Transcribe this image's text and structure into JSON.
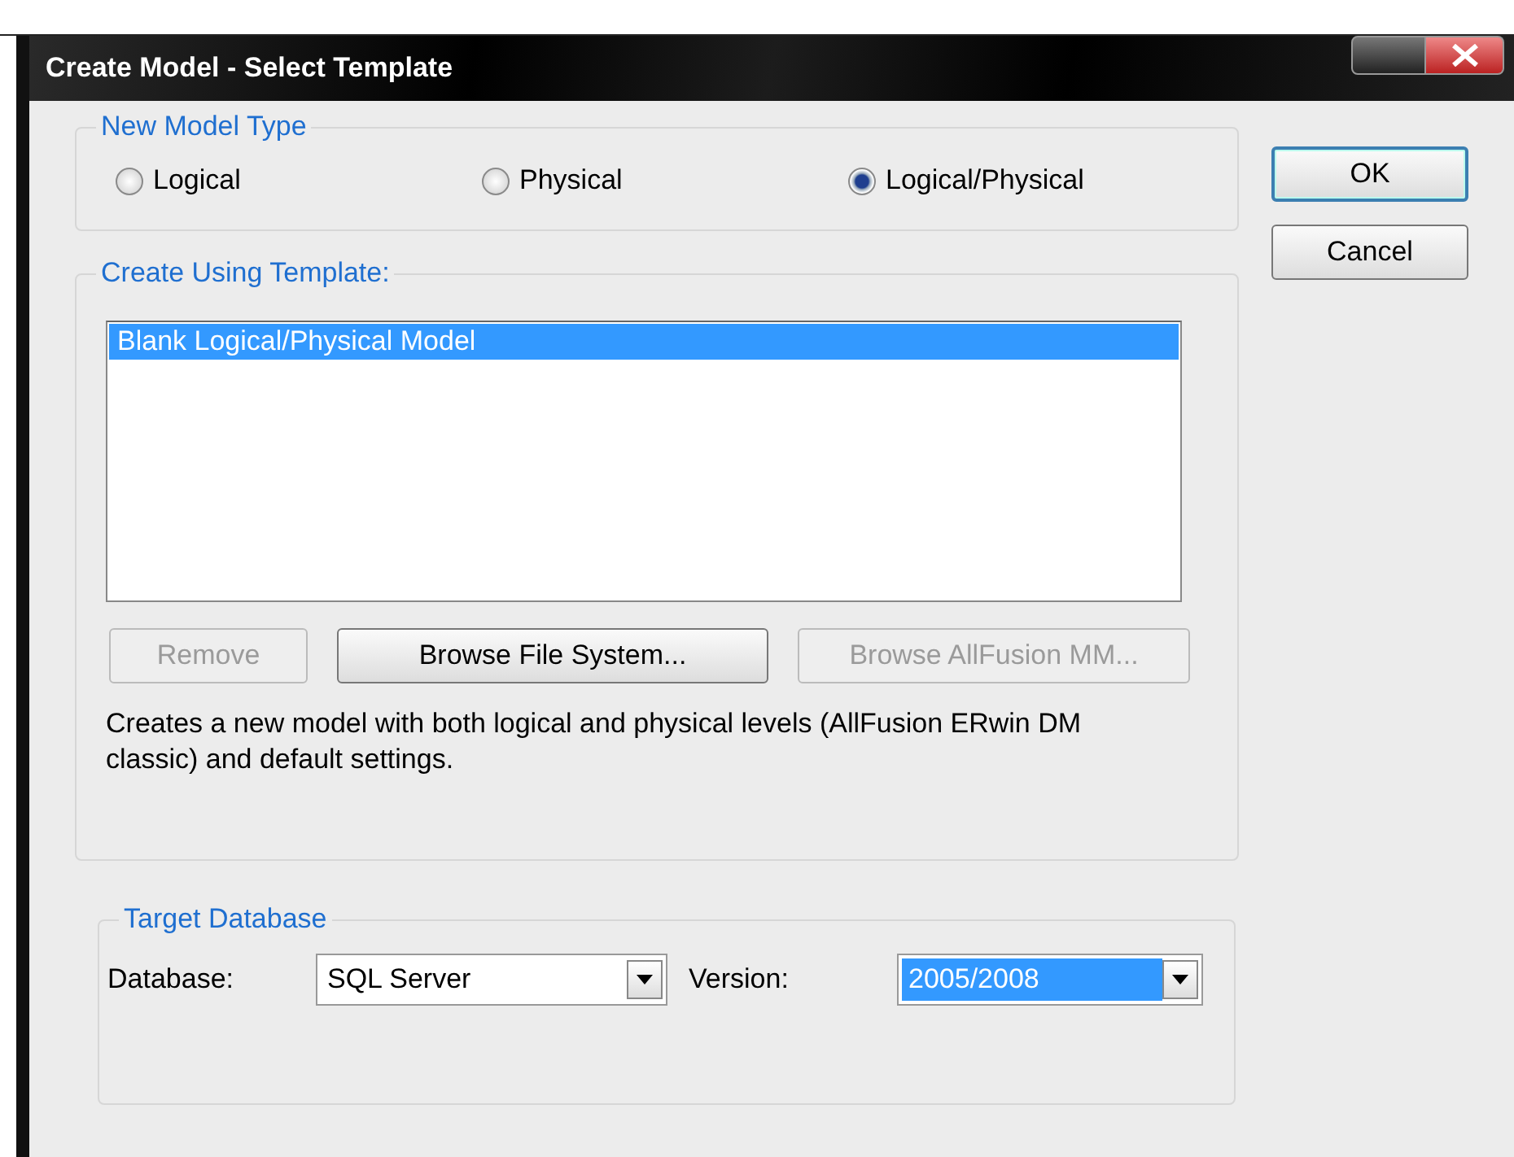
{
  "window": {
    "title": "Create Model - Select Template"
  },
  "model_type": {
    "label": "New Model Type",
    "options": [
      {
        "label": "Logical",
        "selected": false
      },
      {
        "label": "Physical",
        "selected": false
      },
      {
        "label": "Logical/Physical",
        "selected": true
      }
    ]
  },
  "template": {
    "label": "Create Using Template:",
    "items": [
      {
        "label": "Blank Logical/Physical Model",
        "selected": true
      }
    ],
    "buttons": [
      {
        "label": "Remove",
        "disabled": true
      },
      {
        "label": "Browse File System...",
        "disabled": false
      },
      {
        "label": "Browse AllFusion MM...",
        "disabled": true
      }
    ],
    "description": "Creates a new model with both logical and physical levels (AllFusion ERwin DM classic) and default settings."
  },
  "target": {
    "label": "Target Database",
    "database_label": "Database:",
    "database": {
      "value": "SQL Server",
      "highlighted": false
    },
    "version_label": "Version:",
    "version": {
      "value": "2005/2008",
      "highlighted": true
    }
  },
  "buttons": [
    {
      "label": "OK",
      "default": true
    },
    {
      "label": "Cancel",
      "default": false
    }
  ]
}
